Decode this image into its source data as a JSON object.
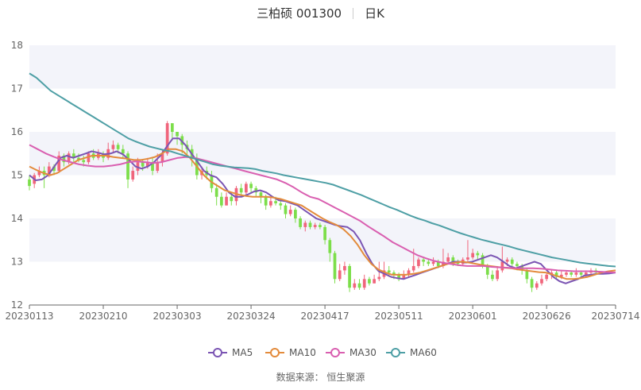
{
  "header": {
    "name": "三柏硕 001300",
    "period": "日K"
  },
  "source": "数据来源： 恒生聚源",
  "colors": {
    "up": "#f0657c",
    "down": "#7cde4a",
    "band": "#f3f4fa",
    "axis": "#666666",
    "ma5": "#7b55b3",
    "ma10": "#e38b3c",
    "ma30": "#d95fb0",
    "ma60": "#4e9fa5"
  },
  "chart_data": {
    "type": "candlestick",
    "ylim": [
      12,
      18
    ],
    "yticks": [
      12,
      13,
      14,
      15,
      16,
      17,
      18
    ],
    "xticks": [
      "20230113",
      "20230210",
      "20230303",
      "20230324",
      "20230417",
      "20230511",
      "20230601",
      "20230626",
      "20230714"
    ],
    "dates": [
      "20230113",
      "20230116",
      "20230117",
      "20230118",
      "20230119",
      "20230120",
      "20230130",
      "20230131",
      "20230201",
      "20230202",
      "20230203",
      "20230206",
      "20230207",
      "20230208",
      "20230209",
      "20230210",
      "20230213",
      "20230214",
      "20230215",
      "20230216",
      "20230217",
      "20230220",
      "20230221",
      "20230222",
      "20230223",
      "20230224",
      "20230227",
      "20230228",
      "20230301",
      "20230302",
      "20230303",
      "20230306",
      "20230307",
      "20230308",
      "20230309",
      "20230310",
      "20230313",
      "20230314",
      "20230315",
      "20230316",
      "20230317",
      "20230320",
      "20230321",
      "20230322",
      "20230323",
      "20230324",
      "20230327",
      "20230328",
      "20230329",
      "20230330",
      "20230331",
      "20230403",
      "20230404",
      "20230406",
      "20230407",
      "20230410",
      "20230411",
      "20230412",
      "20230413",
      "20230414",
      "20230417",
      "20230418",
      "20230419",
      "20230420",
      "20230421",
      "20230424",
      "20230425",
      "20230426",
      "20230427",
      "20230428",
      "20230504",
      "20230505",
      "20230508",
      "20230509",
      "20230510",
      "20230511",
      "20230512",
      "20230515",
      "20230516",
      "20230517",
      "20230518",
      "20230519",
      "20230522",
      "20230523",
      "20230524",
      "20230525",
      "20230526",
      "20230529",
      "20230530",
      "20230531",
      "20230601",
      "20230602",
      "20230605",
      "20230606",
      "20230607",
      "20230608",
      "20230609",
      "20230612",
      "20230613",
      "20230614",
      "20230615",
      "20230616",
      "20230619",
      "20230620",
      "20230621",
      "20230626",
      "20230627",
      "20230628",
      "20230629",
      "20230630",
      "20230703",
      "20230704",
      "20230705",
      "20230706",
      "20230707",
      "20230710",
      "20230711",
      "20230712",
      "20230713",
      "20230714"
    ],
    "ohlc": [
      [
        14.9,
        14.75,
        15.0,
        14.65
      ],
      [
        14.8,
        15.0,
        15.05,
        14.7
      ],
      [
        15.0,
        15.1,
        15.2,
        14.95
      ],
      [
        15.1,
        15.0,
        15.2,
        14.7
      ],
      [
        15.0,
        15.2,
        15.3,
        14.95
      ],
      [
        15.2,
        15.1,
        15.25,
        15.0
      ],
      [
        15.1,
        15.45,
        15.55,
        15.05
      ],
      [
        15.45,
        15.3,
        15.5,
        15.2
      ],
      [
        15.3,
        15.5,
        15.55,
        15.25
      ],
      [
        15.5,
        15.4,
        15.6,
        15.3
      ],
      [
        15.4,
        15.35,
        15.5,
        15.3
      ],
      [
        15.35,
        15.3,
        15.45,
        15.2
      ],
      [
        15.3,
        15.5,
        15.55,
        15.25
      ],
      [
        15.5,
        15.4,
        15.6,
        15.35
      ],
      [
        15.4,
        15.5,
        15.6,
        15.35
      ],
      [
        15.5,
        15.4,
        15.55,
        15.3
      ],
      [
        15.4,
        15.6,
        15.75,
        15.35
      ],
      [
        15.6,
        15.7,
        15.8,
        15.5
      ],
      [
        15.7,
        15.6,
        15.75,
        15.5
      ],
      [
        15.6,
        15.5,
        15.7,
        15.4
      ],
      [
        15.5,
        14.9,
        15.55,
        14.7
      ],
      [
        14.9,
        15.1,
        15.2,
        14.85
      ],
      [
        15.1,
        15.3,
        15.4,
        15.0
      ],
      [
        15.3,
        15.2,
        15.35,
        15.1
      ],
      [
        15.2,
        15.3,
        15.4,
        15.15
      ],
      [
        15.3,
        15.1,
        15.4,
        15.0
      ],
      [
        15.1,
        15.3,
        15.5,
        15.05
      ],
      [
        15.3,
        15.5,
        15.6,
        15.2
      ],
      [
        15.5,
        16.2,
        16.25,
        15.45
      ],
      [
        16.2,
        16.0,
        16.1,
        15.8
      ],
      [
        16.0,
        15.9,
        16.0,
        15.7
      ],
      [
        15.9,
        15.7,
        15.95,
        15.5
      ],
      [
        15.7,
        15.6,
        15.8,
        15.4
      ],
      [
        15.6,
        15.4,
        15.7,
        15.2
      ],
      [
        15.4,
        15.0,
        15.5,
        14.9
      ],
      [
        15.0,
        15.1,
        15.2,
        14.9
      ],
      [
        15.1,
        15.0,
        15.2,
        14.9
      ],
      [
        15.0,
        14.7,
        15.1,
        14.6
      ],
      [
        14.7,
        14.5,
        14.8,
        14.3
      ],
      [
        14.5,
        14.3,
        14.6,
        14.25
      ],
      [
        14.3,
        14.5,
        14.6,
        14.3
      ],
      [
        14.5,
        14.4,
        14.6,
        14.3
      ],
      [
        14.4,
        14.7,
        14.75,
        14.3
      ],
      [
        14.7,
        14.6,
        14.8,
        14.5
      ],
      [
        14.6,
        14.8,
        14.85,
        14.55
      ],
      [
        14.8,
        14.7,
        14.85,
        14.6
      ],
      [
        14.7,
        14.6,
        14.75,
        14.5
      ],
      [
        14.6,
        14.5,
        14.65,
        14.35
      ],
      [
        14.5,
        14.3,
        14.55,
        14.2
      ],
      [
        14.3,
        14.4,
        14.5,
        14.25
      ],
      [
        14.4,
        14.35,
        14.5,
        14.3
      ],
      [
        14.35,
        14.3,
        14.4,
        14.2
      ],
      [
        14.3,
        14.1,
        14.35,
        14.0
      ],
      [
        14.1,
        14.2,
        14.3,
        14.05
      ],
      [
        14.2,
        14.0,
        14.25,
        13.9
      ],
      [
        14.0,
        13.8,
        14.05,
        13.75
      ],
      [
        13.8,
        13.9,
        13.95,
        13.7
      ],
      [
        13.9,
        13.8,
        13.95,
        13.75
      ],
      [
        13.8,
        13.85,
        13.9,
        13.75
      ],
      [
        13.85,
        13.8,
        13.9,
        13.75
      ],
      [
        13.8,
        13.5,
        13.85,
        13.4
      ],
      [
        13.5,
        13.2,
        13.55,
        13.0
      ],
      [
        13.2,
        12.6,
        13.25,
        12.5
      ],
      [
        12.6,
        12.8,
        12.95,
        12.55
      ],
      [
        12.8,
        12.9,
        13.0,
        12.7
      ],
      [
        12.9,
        12.4,
        12.95,
        12.3
      ],
      [
        12.4,
        12.5,
        12.6,
        12.35
      ],
      [
        12.5,
        12.4,
        12.6,
        12.35
      ],
      [
        12.4,
        12.6,
        12.7,
        12.35
      ],
      [
        12.6,
        12.5,
        12.65,
        12.45
      ],
      [
        12.5,
        12.6,
        12.7,
        12.5
      ],
      [
        12.6,
        12.65,
        13.0,
        12.55
      ],
      [
        12.65,
        12.8,
        13.0,
        12.6
      ],
      [
        12.8,
        12.75,
        12.9,
        12.65
      ],
      [
        12.75,
        12.7,
        12.8,
        12.6
      ],
      [
        12.7,
        12.6,
        12.75,
        12.55
      ],
      [
        12.6,
        12.7,
        12.8,
        12.6
      ],
      [
        12.7,
        12.8,
        12.85,
        12.65
      ],
      [
        12.8,
        12.9,
        13.3,
        12.75
      ],
      [
        12.9,
        13.05,
        13.1,
        12.85
      ],
      [
        13.05,
        13.0,
        13.1,
        12.9
      ],
      [
        13.0,
        12.95,
        13.05,
        12.9
      ],
      [
        12.95,
        13.0,
        13.1,
        12.9
      ],
      [
        13.0,
        12.9,
        13.05,
        12.85
      ],
      [
        12.9,
        13.0,
        13.3,
        12.85
      ],
      [
        13.0,
        13.1,
        13.2,
        12.95
      ],
      [
        13.1,
        13.0,
        13.15,
        12.9
      ],
      [
        13.0,
        12.95,
        13.05,
        12.9
      ],
      [
        12.95,
        13.05,
        13.1,
        12.9
      ],
      [
        13.05,
        13.1,
        13.5,
        13.0
      ],
      [
        13.1,
        13.2,
        13.3,
        13.05
      ],
      [
        13.2,
        13.15,
        13.25,
        13.05
      ],
      [
        13.15,
        12.9,
        13.2,
        12.85
      ],
      [
        12.9,
        12.7,
        12.95,
        12.6
      ],
      [
        12.7,
        12.6,
        12.8,
        12.55
      ],
      [
        12.6,
        12.8,
        12.9,
        12.55
      ],
      [
        12.8,
        13.0,
        13.35,
        12.75
      ],
      [
        13.0,
        13.05,
        13.1,
        12.9
      ],
      [
        13.05,
        12.95,
        13.1,
        12.9
      ],
      [
        12.95,
        12.9,
        13.0,
        12.8
      ],
      [
        12.9,
        12.8,
        12.95,
        12.7
      ],
      [
        12.8,
        12.6,
        12.85,
        12.5
      ],
      [
        12.6,
        12.4,
        12.65,
        12.3
      ],
      [
        12.4,
        12.5,
        12.55,
        12.35
      ],
      [
        12.5,
        12.6,
        12.7,
        12.45
      ],
      [
        12.6,
        12.7,
        12.75,
        12.55
      ],
      [
        12.7,
        12.75,
        12.8,
        12.6
      ],
      [
        12.75,
        12.65,
        12.8,
        12.6
      ],
      [
        12.65,
        12.7,
        12.8,
        12.6
      ],
      [
        12.7,
        12.75,
        12.8,
        12.65
      ],
      [
        12.75,
        12.7,
        12.8,
        12.65
      ],
      [
        12.7,
        12.75,
        12.85,
        12.65
      ],
      [
        12.75,
        12.7,
        12.8,
        12.65
      ],
      [
        12.7,
        12.75,
        12.8,
        12.65
      ],
      [
        12.75,
        12.8,
        12.85,
        12.7
      ],
      [
        12.8,
        12.75,
        12.85,
        12.7
      ]
    ],
    "series": [
      {
        "name": "MA5",
        "key": "ma5",
        "values": [
          15.0,
          14.88,
          14.9,
          15.0,
          15.2,
          15.4,
          15.45,
          15.4,
          15.45,
          15.5,
          15.55,
          15.52,
          15.48,
          15.5,
          15.55,
          15.48,
          15.35,
          15.2,
          15.15,
          15.2,
          15.3,
          15.45,
          15.65,
          15.85,
          15.85,
          15.7,
          15.5,
          15.3,
          15.1,
          15.0,
          14.95,
          14.8,
          14.6,
          14.5,
          14.5,
          14.55,
          14.62,
          14.65,
          14.6,
          14.5,
          14.42,
          14.4,
          14.35,
          14.3,
          14.2,
          14.1,
          14.0,
          13.95,
          13.9,
          13.85,
          13.82,
          13.8,
          13.7,
          13.5,
          13.2,
          12.95,
          12.78,
          12.72,
          12.65,
          12.62,
          12.6,
          12.65,
          12.7,
          12.75,
          12.8,
          12.85,
          12.9,
          12.95,
          13.0,
          13.0,
          12.98,
          13.0,
          13.05,
          13.1,
          13.15,
          13.1,
          13.0,
          12.9,
          12.85,
          12.9,
          12.95,
          13.0,
          12.95,
          12.8,
          12.65,
          12.55,
          12.5,
          12.55,
          12.6,
          12.68,
          12.7,
          12.72,
          12.72,
          12.73,
          12.75
        ]
      },
      {
        "name": "MA10",
        "key": "ma10",
        "values": [
          15.2,
          15.12,
          15.05,
          15.0,
          15.05,
          15.15,
          15.25,
          15.35,
          15.4,
          15.45,
          15.45,
          15.45,
          15.42,
          15.4,
          15.38,
          15.35,
          15.35,
          15.38,
          15.42,
          15.5,
          15.6,
          15.6,
          15.55,
          15.4,
          15.2,
          15.0,
          14.85,
          14.75,
          14.65,
          14.6,
          14.55,
          14.52,
          14.5,
          14.5,
          14.5,
          14.48,
          14.45,
          14.4,
          14.35,
          14.3,
          14.2,
          14.1,
          14.0,
          13.92,
          13.85,
          13.75,
          13.6,
          13.4,
          13.15,
          12.95,
          12.82,
          12.75,
          12.7,
          12.7,
          12.7,
          12.72,
          12.75,
          12.8,
          12.85,
          12.9,
          12.95,
          12.98,
          13.0,
          12.98,
          12.95,
          12.92,
          12.9,
          12.88,
          12.86,
          12.85,
          12.82,
          12.8,
          12.78,
          12.76,
          12.75,
          12.7,
          12.65,
          12.6,
          12.6,
          12.62,
          12.65,
          12.7,
          12.75,
          12.78,
          12.8
        ]
      },
      {
        "name": "MA30",
        "key": "ma30",
        "values": [
          15.7,
          15.6,
          15.5,
          15.42,
          15.35,
          15.3,
          15.25,
          15.22,
          15.2,
          15.2,
          15.22,
          15.25,
          15.3,
          15.32,
          15.3,
          15.28,
          15.3,
          15.35,
          15.4,
          15.42,
          15.4,
          15.35,
          15.3,
          15.25,
          15.2,
          15.15,
          15.1,
          15.05,
          15.0,
          14.95,
          14.9,
          14.82,
          14.72,
          14.6,
          14.5,
          14.45,
          14.35,
          14.25,
          14.15,
          14.05,
          13.95,
          13.82,
          13.7,
          13.58,
          13.45,
          13.35,
          13.25,
          13.15,
          13.08,
          13.02,
          12.98,
          12.95,
          12.92,
          12.9,
          12.9,
          12.9,
          12.88,
          12.87,
          12.86,
          12.85,
          12.85,
          12.85,
          12.84,
          12.82,
          12.8,
          12.79,
          12.78,
          12.78,
          12.78,
          12.77,
          12.76,
          12.75
        ]
      },
      {
        "name": "MA60",
        "key": "ma60",
        "values": [
          17.35,
          17.25,
          17.1,
          16.95,
          16.85,
          16.75,
          16.65,
          16.55,
          16.45,
          16.35,
          16.25,
          16.15,
          16.05,
          15.95,
          15.85,
          15.78,
          15.72,
          15.66,
          15.62,
          15.58,
          15.55,
          15.5,
          15.45,
          15.4,
          15.35,
          15.3,
          15.25,
          15.22,
          15.2,
          15.18,
          15.17,
          15.16,
          15.14,
          15.1,
          15.07,
          15.04,
          15.0,
          14.97,
          14.94,
          14.91,
          14.88,
          14.85,
          14.82,
          14.78,
          14.72,
          14.66,
          14.6,
          14.54,
          14.47,
          14.4,
          14.33,
          14.26,
          14.2,
          14.13,
          14.06,
          14.0,
          13.95,
          13.89,
          13.84,
          13.78,
          13.72,
          13.66,
          13.61,
          13.56,
          13.51,
          13.47,
          13.43,
          13.39,
          13.35,
          13.3,
          13.26,
          13.22,
          13.18,
          13.14,
          13.1,
          13.07,
          13.04,
          13.01,
          12.98,
          12.96,
          12.94,
          12.92,
          12.9,
          12.89
        ]
      }
    ]
  }
}
